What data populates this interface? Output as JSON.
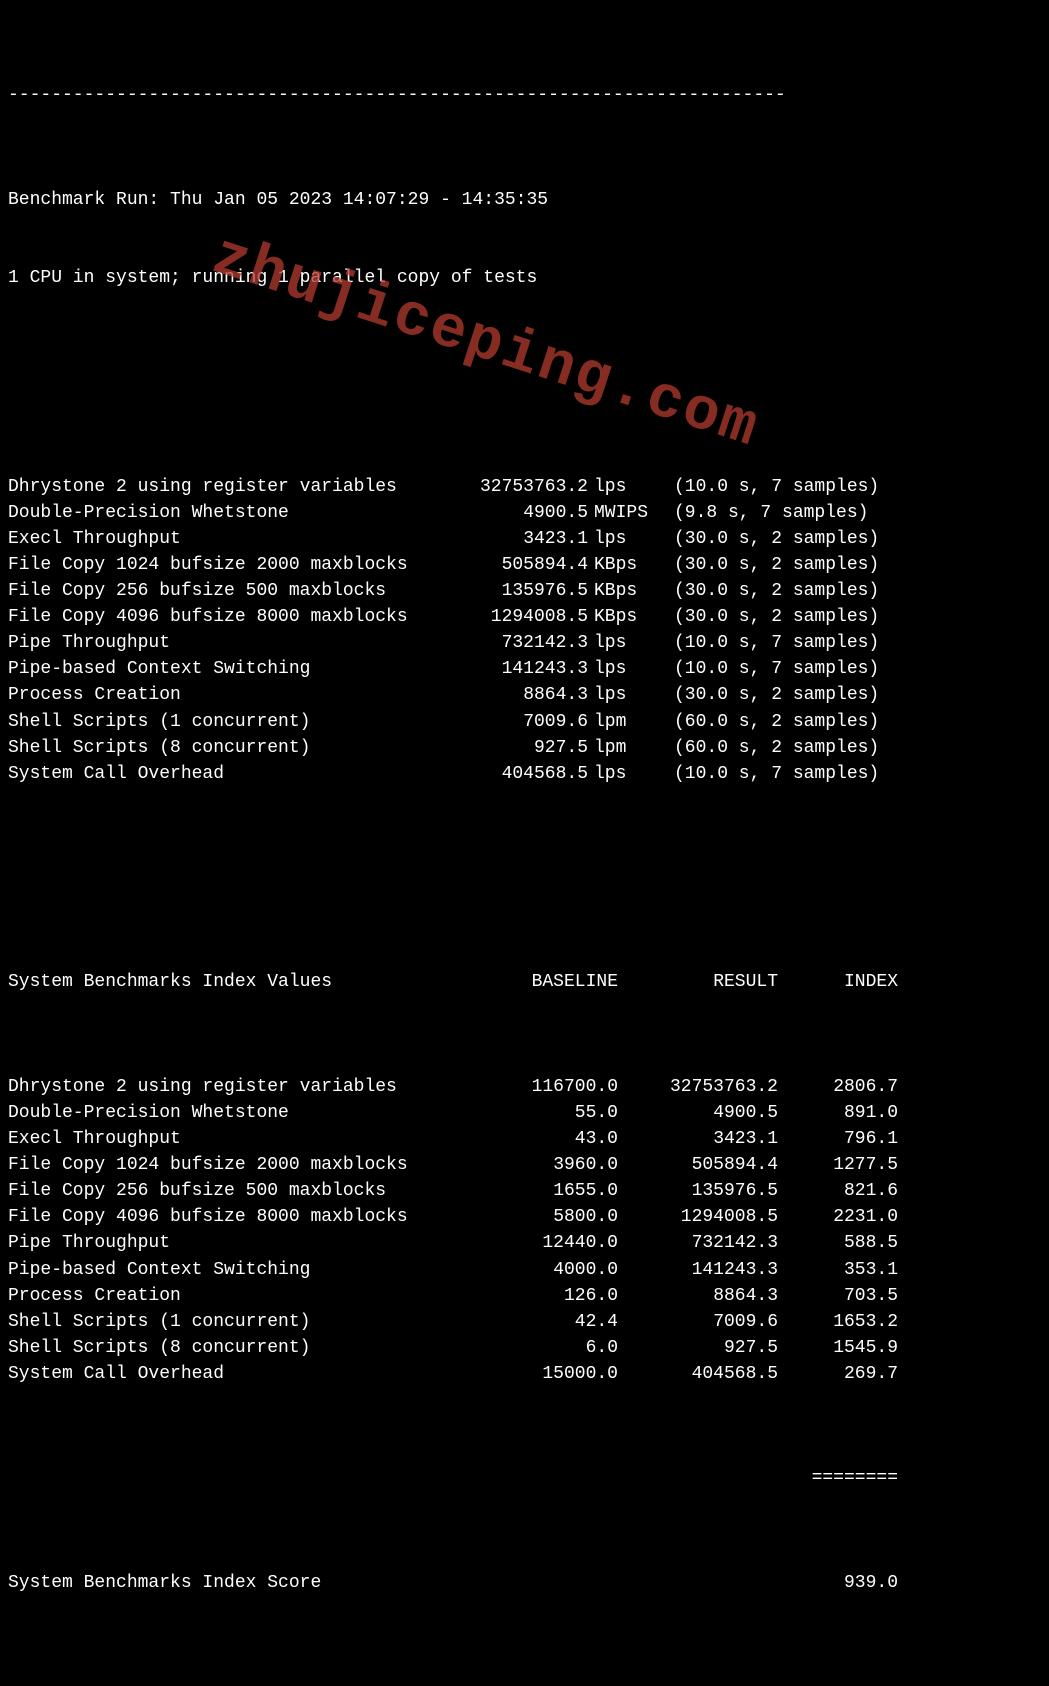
{
  "divider": "------------------------------------------------------------------------",
  "header": {
    "run_line": "Benchmark Run: Thu Jan 05 2023 14:07:29 - 14:35:35",
    "cpu_line": "1 CPU in system; running 1 parallel copy of tests"
  },
  "results": [
    {
      "name": "Dhrystone 2 using register variables",
      "value": "32753763.2",
      "unit": "lps",
      "meta": "(10.0 s, 7 samples)"
    },
    {
      "name": "Double-Precision Whetstone",
      "value": "4900.5",
      "unit": "MWIPS",
      "meta": "(9.8 s, 7 samples)"
    },
    {
      "name": "Execl Throughput",
      "value": "3423.1",
      "unit": "lps",
      "meta": "(30.0 s, 2 samples)"
    },
    {
      "name": "File Copy 1024 bufsize 2000 maxblocks",
      "value": "505894.4",
      "unit": "KBps",
      "meta": "(30.0 s, 2 samples)"
    },
    {
      "name": "File Copy 256 bufsize 500 maxblocks",
      "value": "135976.5",
      "unit": "KBps",
      "meta": "(30.0 s, 2 samples)"
    },
    {
      "name": "File Copy 4096 bufsize 8000 maxblocks",
      "value": "1294008.5",
      "unit": "KBps",
      "meta": "(30.0 s, 2 samples)"
    },
    {
      "name": "Pipe Throughput",
      "value": "732142.3",
      "unit": "lps",
      "meta": "(10.0 s, 7 samples)"
    },
    {
      "name": "Pipe-based Context Switching",
      "value": "141243.3",
      "unit": "lps",
      "meta": "(10.0 s, 7 samples)"
    },
    {
      "name": "Process Creation",
      "value": "8864.3",
      "unit": "lps",
      "meta": "(30.0 s, 2 samples)"
    },
    {
      "name": "Shell Scripts (1 concurrent)",
      "value": "7009.6",
      "unit": "lpm",
      "meta": "(60.0 s, 2 samples)"
    },
    {
      "name": "Shell Scripts (8 concurrent)",
      "value": "927.5",
      "unit": "lpm",
      "meta": "(60.0 s, 2 samples)"
    },
    {
      "name": "System Call Overhead",
      "value": "404568.5",
      "unit": "lps",
      "meta": "(10.0 s, 7 samples)"
    }
  ],
  "index_header": {
    "title": "System Benchmarks Index Values",
    "baseline": "BASELINE",
    "result": "RESULT",
    "index": "INDEX"
  },
  "index_rows": [
    {
      "name": "Dhrystone 2 using register variables",
      "baseline": "116700.0",
      "result": "32753763.2",
      "index": "2806.7"
    },
    {
      "name": "Double-Precision Whetstone",
      "baseline": "55.0",
      "result": "4900.5",
      "index": "891.0"
    },
    {
      "name": "Execl Throughput",
      "baseline": "43.0",
      "result": "3423.1",
      "index": "796.1"
    },
    {
      "name": "File Copy 1024 bufsize 2000 maxblocks",
      "baseline": "3960.0",
      "result": "505894.4",
      "index": "1277.5"
    },
    {
      "name": "File Copy 256 bufsize 500 maxblocks",
      "baseline": "1655.0",
      "result": "135976.5",
      "index": "821.6"
    },
    {
      "name": "File Copy 4096 bufsize 8000 maxblocks",
      "baseline": "5800.0",
      "result": "1294008.5",
      "index": "2231.0"
    },
    {
      "name": "Pipe Throughput",
      "baseline": "12440.0",
      "result": "732142.3",
      "index": "588.5"
    },
    {
      "name": "Pipe-based Context Switching",
      "baseline": "4000.0",
      "result": "141243.3",
      "index": "353.1"
    },
    {
      "name": "Process Creation",
      "baseline": "126.0",
      "result": "8864.3",
      "index": "703.5"
    },
    {
      "name": "Shell Scripts (1 concurrent)",
      "baseline": "42.4",
      "result": "7009.6",
      "index": "1653.2"
    },
    {
      "name": "Shell Scripts (8 concurrent)",
      "baseline": "6.0",
      "result": "927.5",
      "index": "1545.9"
    },
    {
      "name": "System Call Overhead",
      "baseline": "15000.0",
      "result": "404568.5",
      "index": "269.7"
    }
  ],
  "index_sep": "========",
  "index_score": {
    "label": "System Benchmarks Index Score",
    "value": "939.0"
  },
  "watermark": "zhujiceping.com"
}
